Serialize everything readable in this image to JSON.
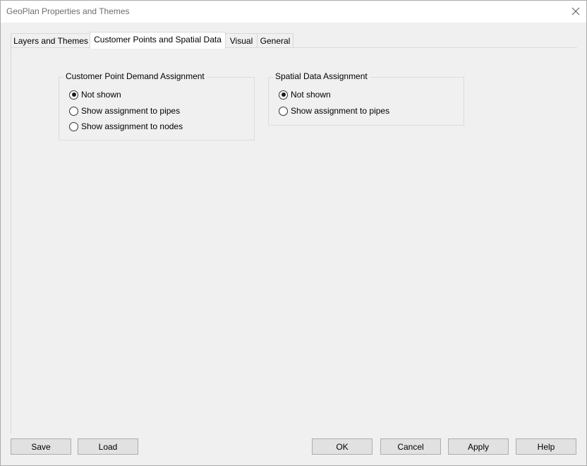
{
  "window": {
    "title": "GeoPlan Properties and Themes"
  },
  "tabs": [
    {
      "label": "Layers and Themes"
    },
    {
      "label": "Customer Points and Spatial Data"
    },
    {
      "label": "Visual"
    },
    {
      "label": "General"
    }
  ],
  "active_tab": "Customer Points and Spatial Data",
  "customer_point_group": {
    "legend": "Customer Point Demand Assignment",
    "options": [
      {
        "label": "Not shown",
        "checked": true
      },
      {
        "label": "Show assignment to pipes",
        "checked": false
      },
      {
        "label": "Show assignment to nodes",
        "checked": false
      }
    ]
  },
  "spatial_data_group": {
    "legend": "Spatial Data Assignment",
    "options": [
      {
        "label": "Not shown",
        "checked": true
      },
      {
        "label": "Show assignment to pipes",
        "checked": false
      }
    ]
  },
  "buttons": {
    "save": "Save",
    "load": "Load",
    "ok": "OK",
    "cancel": "Cancel",
    "apply": "Apply",
    "help": "Help"
  },
  "icons": {
    "close": "close-icon"
  }
}
